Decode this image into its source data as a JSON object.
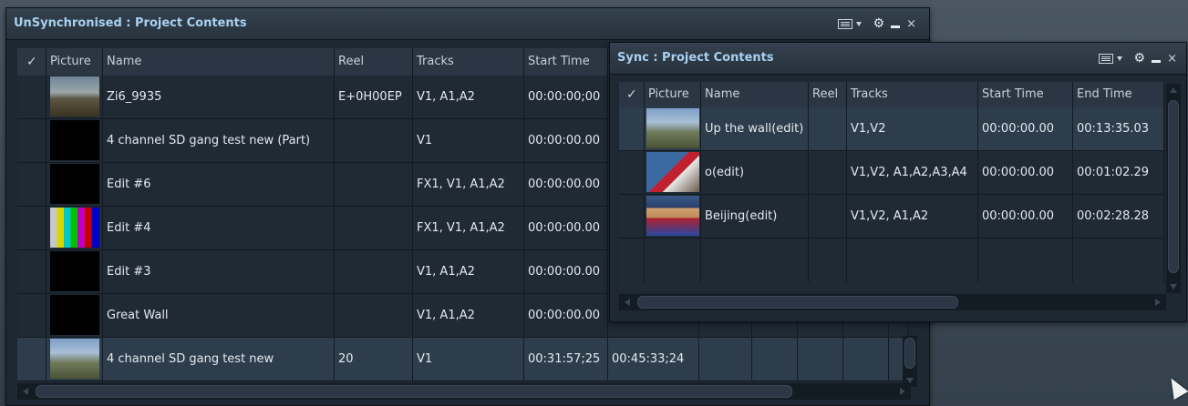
{
  "left_panel": {
    "title": "UnSynchronised : Project Contents",
    "columns": {
      "check": "✓",
      "picture": "Picture",
      "name": "Name",
      "reel": "Reel",
      "tracks": "Tracks",
      "start_time": "Start Time"
    },
    "rows": [
      {
        "name": "Zi6_9935",
        "reel": "E+0H00EP",
        "tracks": "V1, A1,A2",
        "start": "00:00:00;00",
        "end": "",
        "thumb": "landscape"
      },
      {
        "name": "4 channel SD gang test new (Part)",
        "reel": "",
        "tracks": "V1",
        "start": "00:00:00.00",
        "end": "",
        "thumb": "black"
      },
      {
        "name": "Edit #6",
        "reel": "",
        "tracks": "FX1, V1, A1,A2",
        "start": "00:00:00.00",
        "end": "",
        "thumb": "black"
      },
      {
        "name": "Edit #4",
        "reel": "",
        "tracks": "FX1, V1, A1,A2",
        "start": "00:00:00.00",
        "end": "",
        "thumb": "bars"
      },
      {
        "name": "Edit #3",
        "reel": "",
        "tracks": "V1, A1,A2",
        "start": "00:00:00.00",
        "end": "",
        "thumb": "black"
      },
      {
        "name": "Great Wall",
        "reel": "",
        "tracks": "V1, A1,A2",
        "start": "00:00:00.00",
        "end": "",
        "thumb": "black"
      },
      {
        "name": "4 channel SD gang test new",
        "reel": "20",
        "tracks": "V1",
        "start": "00:31:57;25",
        "end": "00:45:33;24",
        "thumb": "mountain",
        "selected": true
      }
    ]
  },
  "right_panel": {
    "title": "Sync : Project Contents",
    "columns": {
      "check": "✓",
      "picture": "Picture",
      "name": "Name",
      "reel": "Reel",
      "tracks": "Tracks",
      "start_time": "Start Time",
      "end_time": "End Time"
    },
    "rows": [
      {
        "name": "Up the wall(edit)",
        "reel": "",
        "tracks": "V1,V2",
        "start": "00:00:00.00",
        "end": "00:13:35.03",
        "thumb": "mountain",
        "selected": true
      },
      {
        "name": "o(edit)",
        "reel": "",
        "tracks": "V1,V2, A1,A2,A3,A4",
        "start": "00:00:00.00",
        "end": "00:01:02.29",
        "thumb": "cartoon"
      },
      {
        "name": "Beijing(edit)",
        "reel": "",
        "tracks": "V1,V2, A1,A2",
        "start": "00:00:00.00",
        "end": "00:02:28.28",
        "thumb": "hero"
      }
    ]
  },
  "window_controls": {
    "menu_icon": "list-menu-icon",
    "settings_icon": "gear-icon",
    "minimize_icon": "minimize-icon",
    "close_icon": "close-icon",
    "close_glyph": "×",
    "gear_glyph": "⚙"
  }
}
